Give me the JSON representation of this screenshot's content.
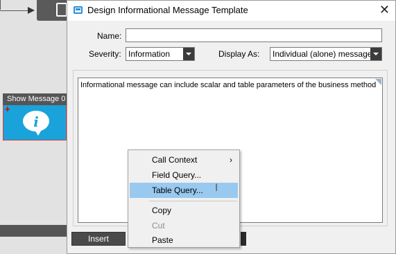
{
  "background": {
    "node_label": "Show Message 0",
    "plus_sign": "+",
    "info_glyph": "i"
  },
  "dialog": {
    "title": "Design Informational Message Template",
    "close_glyph": "✕",
    "name_label": "Name:",
    "name_value": "",
    "severity_label": "Severity:",
    "severity_value": "Information",
    "display_as_label": "Display As:",
    "display_as_value": "Individual (alone) message",
    "message_text": "Informational message can include scalar and table parameters of the business method",
    "insert_label": "Insert"
  },
  "context_menu": {
    "items": [
      {
        "label": "Call Context",
        "submenu_glyph": "›"
      },
      {
        "label": "Field Query..."
      },
      {
        "label": "Table Query..."
      },
      {
        "label": "Copy"
      },
      {
        "label": "Cut"
      },
      {
        "label": "Paste"
      }
    ],
    "cursor_glyph": "I"
  },
  "colors": {
    "accent": "#2a8fd6",
    "highlight": "#99c9ef",
    "node_blue": "#1aa3db"
  }
}
